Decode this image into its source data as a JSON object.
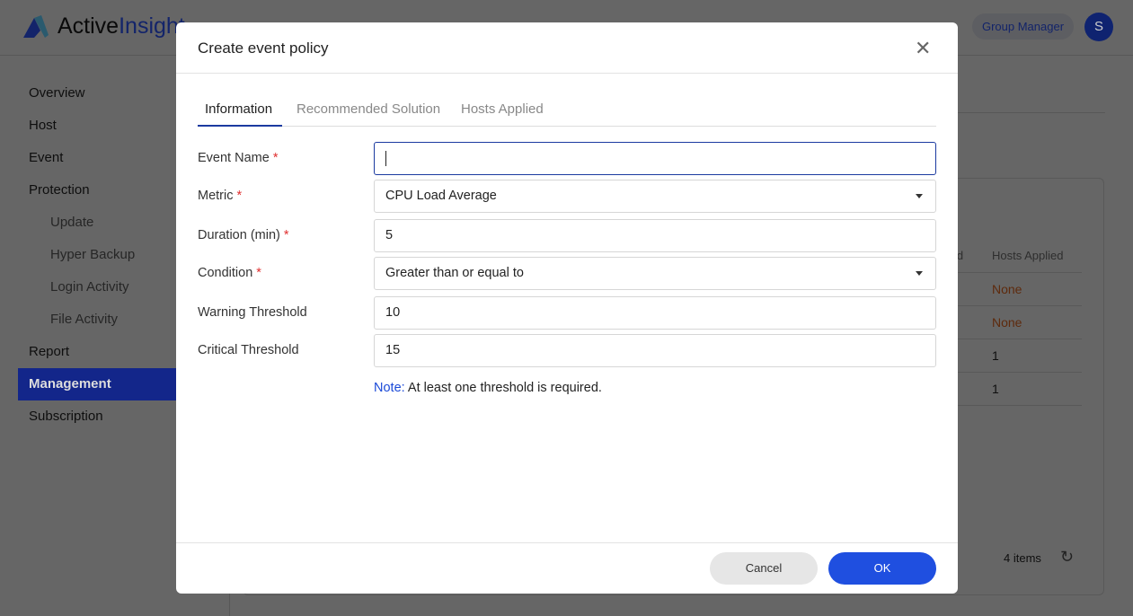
{
  "app": {
    "logo_part1": "Active",
    "logo_part2": "Insight",
    "role": "Group Manager",
    "avatar_letter": "S"
  },
  "sidebar": {
    "items": [
      {
        "label": "Overview",
        "sub": false
      },
      {
        "label": "Host",
        "sub": false
      },
      {
        "label": "Event",
        "sub": false
      },
      {
        "label": "Protection",
        "sub": false
      },
      {
        "label": "Update",
        "sub": true
      },
      {
        "label": "Hyper Backup",
        "sub": true
      },
      {
        "label": "Login Activity",
        "sub": true
      },
      {
        "label": "File Activity",
        "sub": true
      },
      {
        "label": "Report",
        "sub": false
      },
      {
        "label": "Management",
        "sub": false,
        "active": true
      },
      {
        "label": "Subscription",
        "sub": false
      }
    ]
  },
  "table": {
    "headers": [
      "ld",
      "Hosts Applied"
    ],
    "rows": [
      [
        "None"
      ],
      [
        "None"
      ],
      [
        "1"
      ],
      [
        "1"
      ]
    ],
    "items_count": "4 items"
  },
  "modal": {
    "title": "Create event policy",
    "tabs": [
      "Information",
      "Recommended Solution",
      "Hosts Applied"
    ],
    "fields": [
      {
        "label": "Event Name",
        "required": true,
        "value": "",
        "type": "text"
      },
      {
        "label": "Metric",
        "required": true,
        "value": "CPU Load Average",
        "type": "select"
      },
      {
        "label": "Duration (min)",
        "required": true,
        "value": "5",
        "type": "text"
      },
      {
        "label": "Condition",
        "required": true,
        "value": "Greater than or equal to",
        "type": "select"
      },
      {
        "label": "Warning Threshold",
        "required": false,
        "value": "10",
        "type": "text"
      },
      {
        "label": "Critical Threshold",
        "required": false,
        "value": "15",
        "type": "text"
      }
    ],
    "note_label": "Note:",
    "note_text": " At least one threshold is required.",
    "cancel": "Cancel",
    "ok": "OK"
  },
  "colors": {
    "accent": "#1b3aa0",
    "primary_button": "#1f4fe0",
    "warning_text": "#c0561a"
  }
}
